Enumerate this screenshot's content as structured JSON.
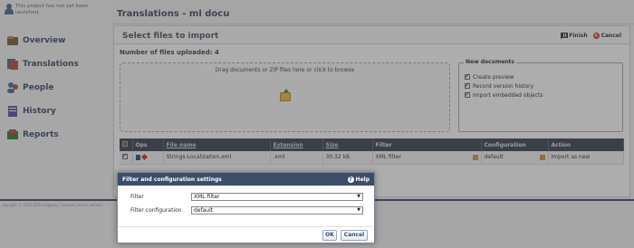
{
  "sidebar": {
    "notice": "This project has not yet been launched.",
    "items": [
      {
        "label": "Overview",
        "icon": "overview-icon"
      },
      {
        "label": "Translations",
        "icon": "translations-icon"
      },
      {
        "label": "People",
        "icon": "people-icon"
      },
      {
        "label": "History",
        "icon": "history-icon"
      },
      {
        "label": "Reports",
        "icon": "reports-icon"
      }
    ],
    "copyright": "opyright © 2011-2024 Digipay | memoQ server version"
  },
  "main": {
    "title": "Translations - ml docu",
    "panel": {
      "title": "Select files to import",
      "finish_label": "Finish",
      "cancel_label": "Cancel",
      "upload_count": "Number of files uploaded: 4",
      "dropzone_text": "Drag documents or ZIP files here or click to browse",
      "new_documents": {
        "legend": "New documents",
        "options": [
          {
            "label": "Create preview",
            "checked": true
          },
          {
            "label": "Record version history",
            "checked": true
          },
          {
            "label": "Import embedded objects",
            "checked": true
          }
        ]
      },
      "table": {
        "headers": [
          "Ops",
          "File name",
          "Extension",
          "Size",
          "Filter",
          "Configuration",
          "Action"
        ],
        "rows": [
          {
            "file": "Strings-Localization.xml",
            "ext": ".xml",
            "size": "30.32 kB",
            "filter": "XML filter",
            "config": "default",
            "action": "Import as new"
          }
        ]
      }
    }
  },
  "dialog": {
    "title": "Filter and configuration settings",
    "help_label": "Help",
    "filter_label": "Filter",
    "filter_value": "XML filter",
    "config_label": "Filter configuration",
    "config_value": "default",
    "ok_label": "OK",
    "cancel_label": "Cancel"
  }
}
